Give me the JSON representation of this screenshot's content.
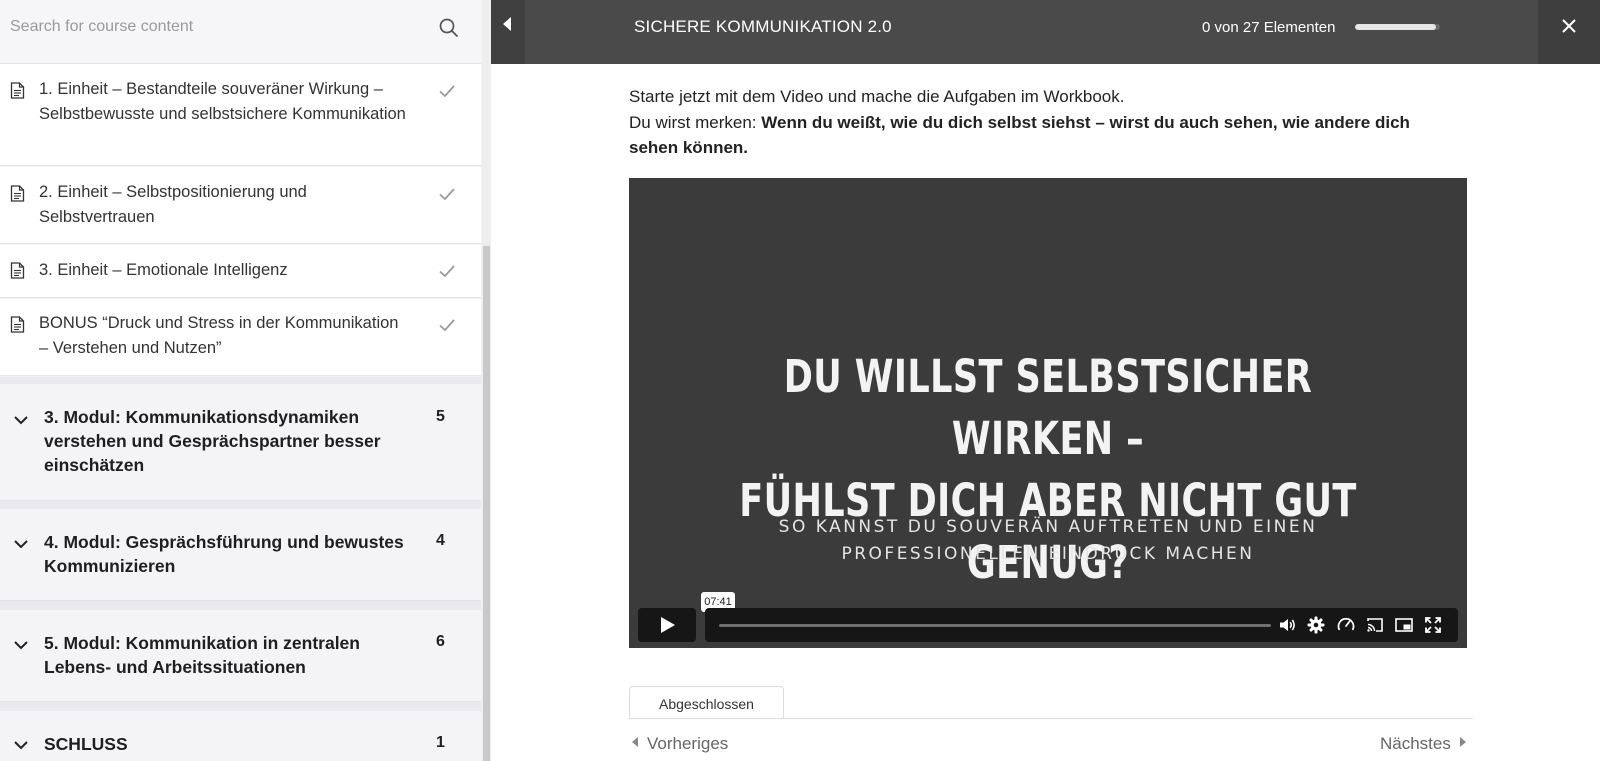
{
  "sidebar": {
    "search_placeholder": "Search for course content",
    "lessons": [
      {
        "label": "1. Einheit – Bestandteile souveräner Wirkung – Selbstbewusste und selbstsichere Kommunikation",
        "completed": true
      },
      {
        "label": "2. Einheit – Selbstpositionierung und Selbstvertrauen",
        "completed": true
      },
      {
        "label": "3. Einheit – Emotionale Intelligenz",
        "completed": true
      },
      {
        "label": "BONUS “Druck und Stress in der Kommunikation – Verstehen und Nutzen”",
        "completed": true
      }
    ],
    "modules": [
      {
        "title": "3. Modul: Kommunikationsdynamiken verstehen und Gesprächspartner besser einschätzen",
        "count": "5"
      },
      {
        "title": "4. Modul: Gesprächsführung und bewustes Kommunizieren",
        "count": "4"
      },
      {
        "title": "5. Modul: Kommunikation in zentralen Lebens- und Arbeitssituationen",
        "count": "6"
      },
      {
        "title": "SCHLUSS",
        "count": "1"
      }
    ]
  },
  "topbar": {
    "course_title": "SICHERE KOMMUNIKATION 2.0",
    "progress_text": "0 von 27 Elementen",
    "progress_fraction": 0.95
  },
  "content": {
    "intro_line1": "Starte jetzt mit dem Video und mache die Aufgaben im Workbook.",
    "intro_line2_prefix": "Du wirst merken: ",
    "intro_line2_bold": "Wenn du weißt, wie du dich selbst siehst – wirst du auch sehen, wie andere dich sehen können.",
    "video": {
      "headline_line1": "DU WILLST SELBSTSICHER WIRKEN –",
      "headline_line2": "FÜHLST DICH ABER NICHT GUT GENUG?",
      "sub_line1": "SO KANNST DU SOUVERÄN AUFTRETEN UND EINEN",
      "sub_line2": "PROFESSIONELLEN EINDRUCK MACHEN",
      "duration": "07:41"
    },
    "completed_tab": "Abgeschlossen",
    "prev_label": "Vorheriges",
    "next_label": "Nächstes"
  },
  "colors": {
    "topbar": "#4a4a4a",
    "sidebar": "#f2f2f5",
    "video_bg": "#3b3b3b"
  }
}
